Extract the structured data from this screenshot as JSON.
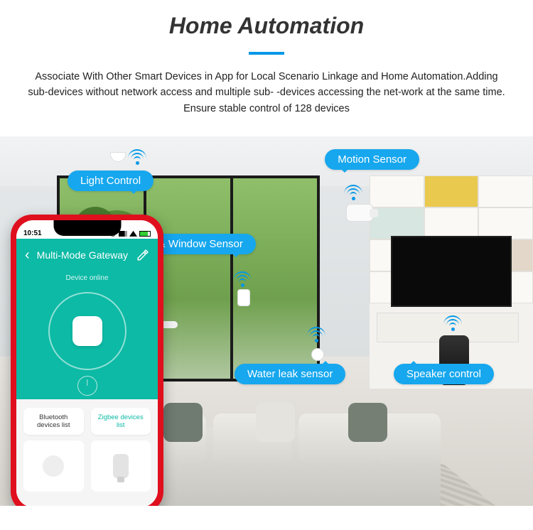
{
  "header": {
    "title": "Home Automation",
    "description": "Associate With Other Smart Devices in App for Local Scenario Linkage and  Home Automation.Adding sub-devices without network access and multiple sub- -devices accessing the net-work at the same time. Ensure stable control of 128 devices"
  },
  "callouts": {
    "light": "Light Control",
    "motion": "Motion Sensor",
    "door": "Door & Window Sensor",
    "water": "Water leak sensor",
    "speaker": "Speaker control"
  },
  "phone": {
    "time": "10:51",
    "carrier_extra": "@",
    "app_title": "Multi-Mode Gateway",
    "hero_sub": "Device online",
    "tab_bluetooth": "Bluetooth devices list",
    "tab_zigbee": "Zigbee devices list"
  },
  "colors": {
    "accent": "#16a7ee",
    "teal": "#0cbaa5",
    "phone_frame": "#e00f1e"
  }
}
